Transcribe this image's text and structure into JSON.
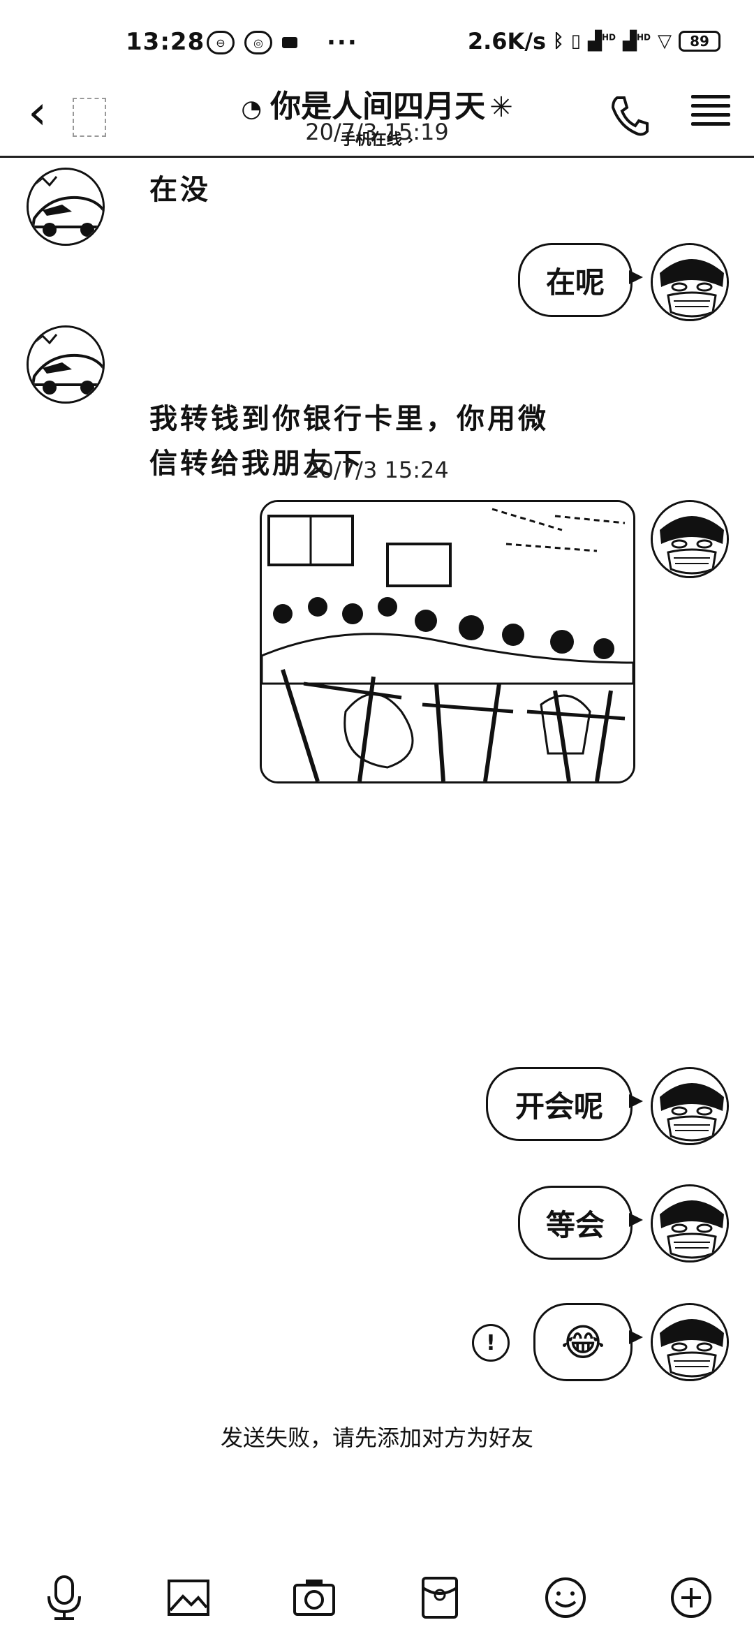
{
  "status_bar": {
    "time": "13:28",
    "speed": "2.6K/s",
    "signal_1": "HD",
    "signal_2": "HD",
    "battery": "89"
  },
  "header": {
    "back_glyph": "‹",
    "title": "你是人间四月天",
    "subtitle": "手机在线 ›"
  },
  "chat": {
    "messages": [
      {
        "type": "timestamp",
        "text": "20/7/3 15:19"
      },
      {
        "type": "text",
        "side": "left",
        "text": "在没"
      },
      {
        "type": "text",
        "side": "right",
        "text": "在呢"
      },
      {
        "type": "text",
        "side": "left",
        "text_line1": "我转钱到你银行卡里，你用微",
        "text_line2": "信转给我朋友下"
      },
      {
        "type": "timestamp",
        "text": "20/7/3 15:24"
      },
      {
        "type": "image",
        "side": "right",
        "description_icon": "photo-classroom"
      },
      {
        "type": "text",
        "side": "right",
        "text": "开会呢"
      },
      {
        "type": "text",
        "side": "right",
        "text": "等会"
      },
      {
        "type": "emoji",
        "side": "right",
        "emoji": "😂",
        "status_icon": "!"
      }
    ],
    "failure_notice": "发送失败，请先添加对方为好友"
  },
  "toolbar": {
    "icons": [
      "mic-icon",
      "image-icon",
      "camera-icon",
      "red-packet-icon",
      "emoji-icon",
      "plus-icon"
    ]
  }
}
